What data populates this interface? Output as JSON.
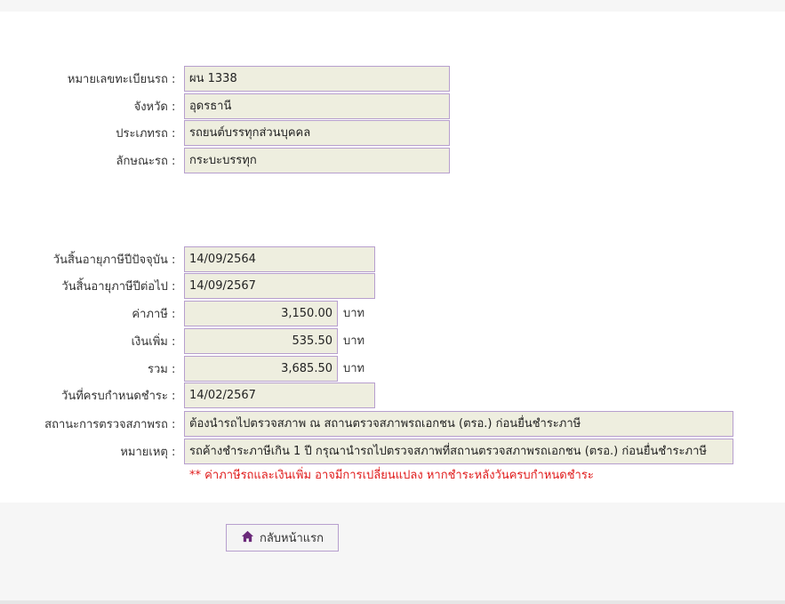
{
  "vehicle": {
    "plate_label": "หมายเลขทะเบียนรถ",
    "plate_value": "ผน 1338",
    "province_label": "จังหวัด",
    "province_value": "อุดรธานี",
    "type_label": "ประเภทรถ",
    "type_value": "รถยนต์บรรทุกส่วนบุคคล",
    "style_label": "ลักษณะรถ",
    "style_value": "กระบะบรรทุก"
  },
  "tax": {
    "current_expiry_label": "วันสิ้นอายุภาษีปีปัจจุบัน",
    "current_expiry_value": "14/09/2564",
    "next_expiry_label": "วันสิ้นอายุภาษีปีต่อไป",
    "next_expiry_value": "14/09/2567",
    "tax_label": "ค่าภาษี",
    "tax_value": "3,150.00",
    "surcharge_label": "เงินเพิ่ม",
    "surcharge_value": "535.50",
    "total_label": "รวม",
    "total_value": "3,685.50",
    "unit": "บาท",
    "due_label": "วันที่ครบกำหนดชำระ",
    "due_value": "14/02/2567",
    "inspection_label": "สถานะการตรวจสภาพรถ",
    "inspection_value": "ต้องนำรถไปตรวจสภาพ ณ สถานตรวจสภาพรถเอกชน (ตรอ.) ก่อนยื่นชำระภาษี",
    "remark_label": "หมายเหตุ",
    "remark_value": "รถค้างชำระภาษีเกิน 1 ปี กรุณานำรถไปตรวจสภาพที่สถานตรวจสภาพรถเอกชน (ตรอ.) ก่อนยื่นชำระภาษี",
    "colon": ":"
  },
  "note": "** ค่าภาษีรถและเงินเพิ่ม อาจมีการเปลี่ยนแปลง หากชำระหลังวันครบกำหนดชำระ",
  "home_button": {
    "label": "กลับหน้าแรก",
    "icon": "home-icon",
    "icon_color": "#6b2a7a"
  },
  "colors": {
    "field_bg": "#eeeedf",
    "field_border": "#b79fce",
    "note_color": "#e01b1b"
  }
}
